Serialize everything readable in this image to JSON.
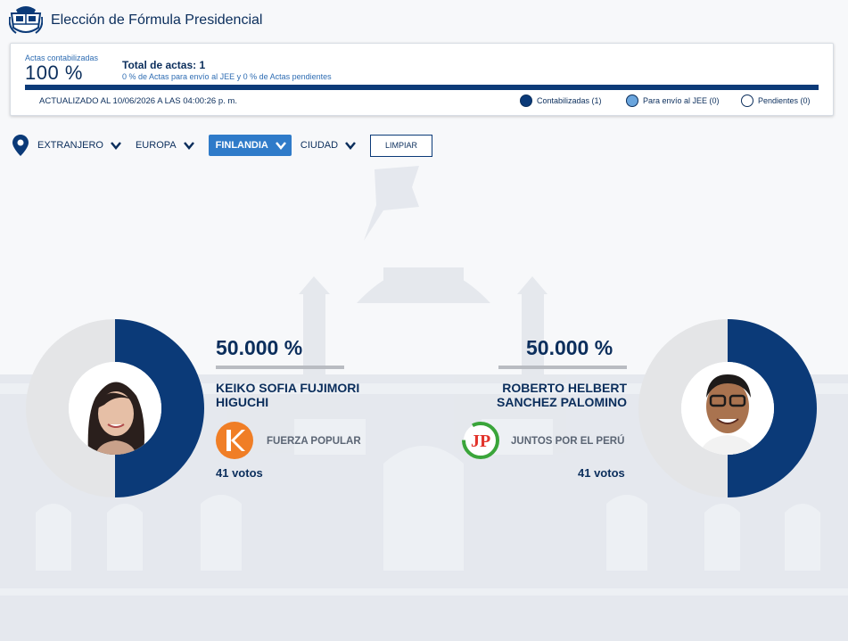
{
  "header": {
    "title": "Elección de Fórmula Presidencial",
    "logo_icon": "peru-coat-of-arms-icon"
  },
  "progress": {
    "actas_label": "Actas contabilizadas",
    "actas_percent": "100 %",
    "actas_fraction": 1.0,
    "total_label": "Total de actas: 1",
    "sub_label": "0 % de Actas para envío al JEE y 0 % de Actas pendientes",
    "updated": "ACTUALIZADO AL 10/06/2026 A LAS 04:00:26 p. m.",
    "legend": [
      {
        "label": "Contabilizadas (1)",
        "color": "#0b3a78"
      },
      {
        "label": "Para envío al JEE (0)",
        "color": "#6aa5dd"
      },
      {
        "label": "Pendientes (0)",
        "color": "#ffffff"
      }
    ]
  },
  "filters": {
    "location_icon": "map-pin-icon",
    "items": [
      {
        "label": "EXTRANJERO",
        "active": false
      },
      {
        "label": "EUROPA",
        "active": false
      },
      {
        "label": "FINLANDIA",
        "active": true
      },
      {
        "label": "CIUDAD",
        "active": false
      }
    ],
    "clear_label": "LIMPIAR"
  },
  "candidates": [
    {
      "percent": "50.000 %",
      "share": 0.5,
      "name_line1": "KEIKO SOFIA FUJIMORI",
      "name_line2": "HIGUCHI",
      "party": "FUERZA POPULAR",
      "votes": "41 votos",
      "party_color": "#f07e26"
    },
    {
      "percent": "50.000 %",
      "share": 0.5,
      "name_line1": "ROBERTO HELBERT",
      "name_line2": "SANCHEZ PALOMINO",
      "party": "JUNTOS POR EL PERÚ",
      "votes": "41 votos",
      "party_color": "#e2332b"
    }
  ],
  "colors": {
    "navy": "#0b3a78",
    "donut_track": "#e4e5e7",
    "accent": "#2f7bc9"
  }
}
